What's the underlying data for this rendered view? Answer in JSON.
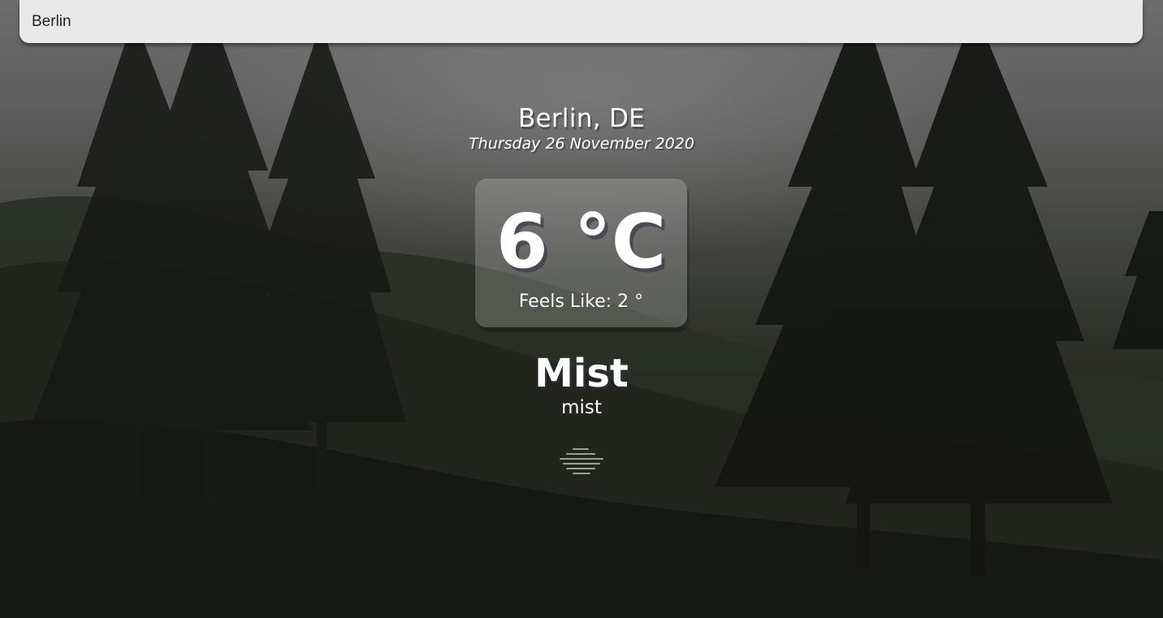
{
  "search": {
    "value": "Berlin"
  },
  "location": {
    "city_country": "Berlin, DE",
    "date": "Thursday 26 November 2020"
  },
  "temperature": {
    "value": "6 °C",
    "feels_like": "Feels Like: 2 °"
  },
  "weather": {
    "main": "Mist",
    "description": "mist",
    "icon": "mist-icon"
  },
  "colors": {
    "text": "#ffffff",
    "search_background": "#e8e9e8",
    "card_background": "rgba(255,255,255,0.2)"
  }
}
